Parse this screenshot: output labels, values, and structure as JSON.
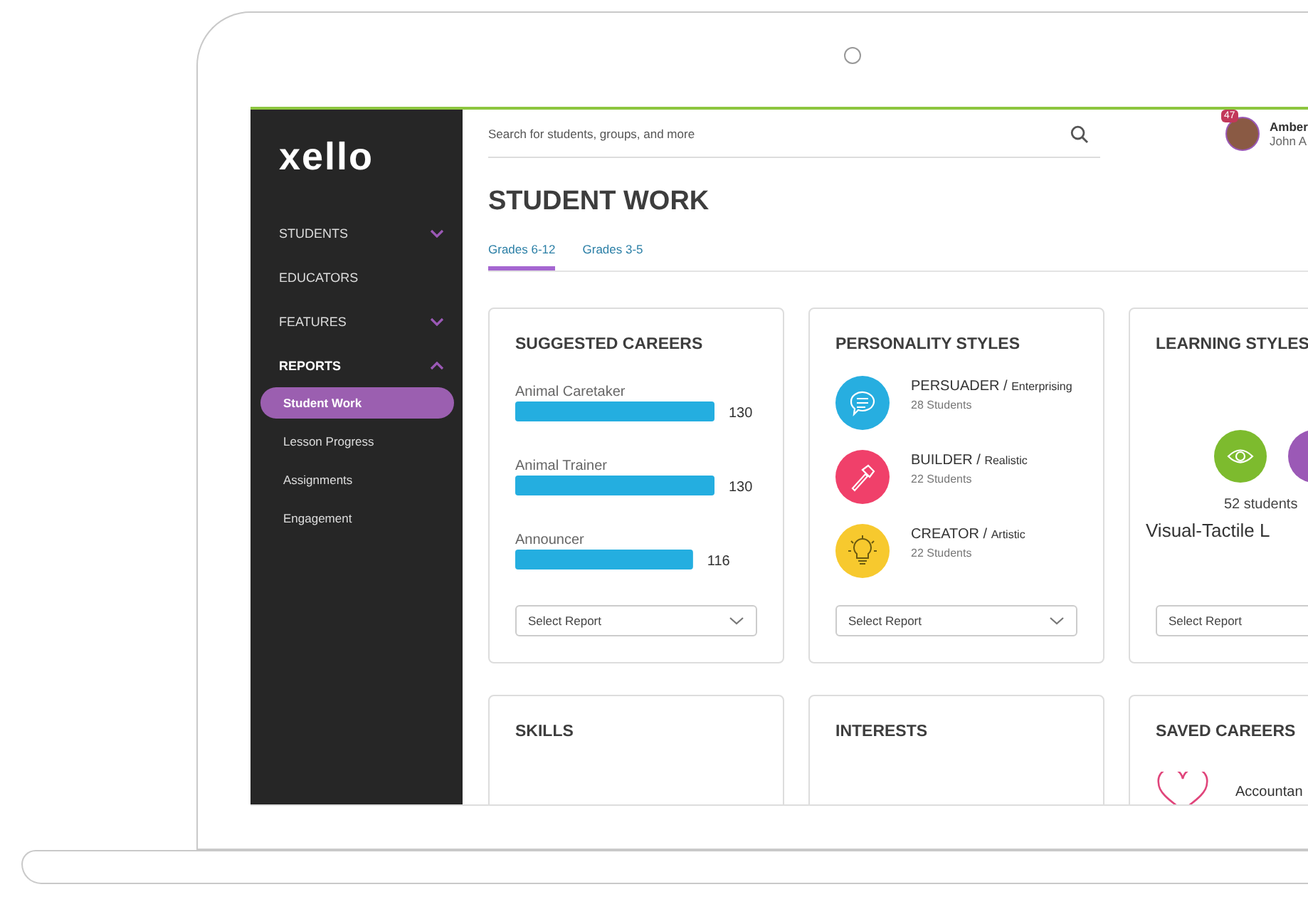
{
  "sidebar": {
    "logo": "xello",
    "items": [
      {
        "label": "STUDENTS",
        "expanded": false
      },
      {
        "label": "EDUCATORS"
      },
      {
        "label": "FEATURES",
        "expanded": false
      },
      {
        "label": "REPORTS",
        "expanded": true,
        "children": [
          {
            "label": "Student Work",
            "selected": true
          },
          {
            "label": "Lesson Progress",
            "selected": false
          },
          {
            "label": "Assignments",
            "selected": false
          },
          {
            "label": "Engagement",
            "selected": false
          }
        ]
      }
    ]
  },
  "search": {
    "placeholder": "Search for students, groups, and more"
  },
  "user": {
    "badge": "47",
    "name": "Amber",
    "subtitle": "John A"
  },
  "page_title": "STUDENT WORK",
  "tabs": [
    {
      "label": "Grades 6-12",
      "selected": true
    },
    {
      "label": "Grades 3-5",
      "selected": false
    }
  ],
  "cards": [
    {
      "kind": "careers",
      "title": "SUGGESTED CAREERS",
      "chart_data": {
        "type": "bar",
        "orientation": "horizontal",
        "categories": [
          "Animal Caretaker",
          "Animal Trainer",
          "Announcer"
        ],
        "values": [
          130,
          130,
          116
        ],
        "data_labels": true
      },
      "select": "Select Report"
    },
    {
      "kind": "personality",
      "title": "PERSONALITY STYLES",
      "styles": [
        {
          "color": "#27aee0",
          "name": "PERSUADER /",
          "trait": "Enterprising",
          "students": "28 Students"
        },
        {
          "color": "#f0406a",
          "name": "BUILDER /",
          "trait": "Realistic",
          "students": "22 Students"
        },
        {
          "color": "#f7c92e",
          "name": "CREATOR /",
          "trait": "Artistic",
          "students": "22 Students"
        }
      ],
      "select": "Select Report"
    },
    {
      "kind": "learning",
      "title": "LEARNING STYLES",
      "circles": [
        {
          "color": "#7dbb2e"
        },
        {
          "color": "#9b59b6"
        }
      ],
      "students": "52 students",
      "style": "Visual-Tactile L",
      "select": "Select Report"
    },
    {
      "kind": "empty",
      "title": "SKILLS"
    },
    {
      "kind": "empty",
      "title": "INTERESTS"
    },
    {
      "kind": "saved",
      "title": "SAVED CAREERS",
      "career": "Accountan"
    }
  ]
}
